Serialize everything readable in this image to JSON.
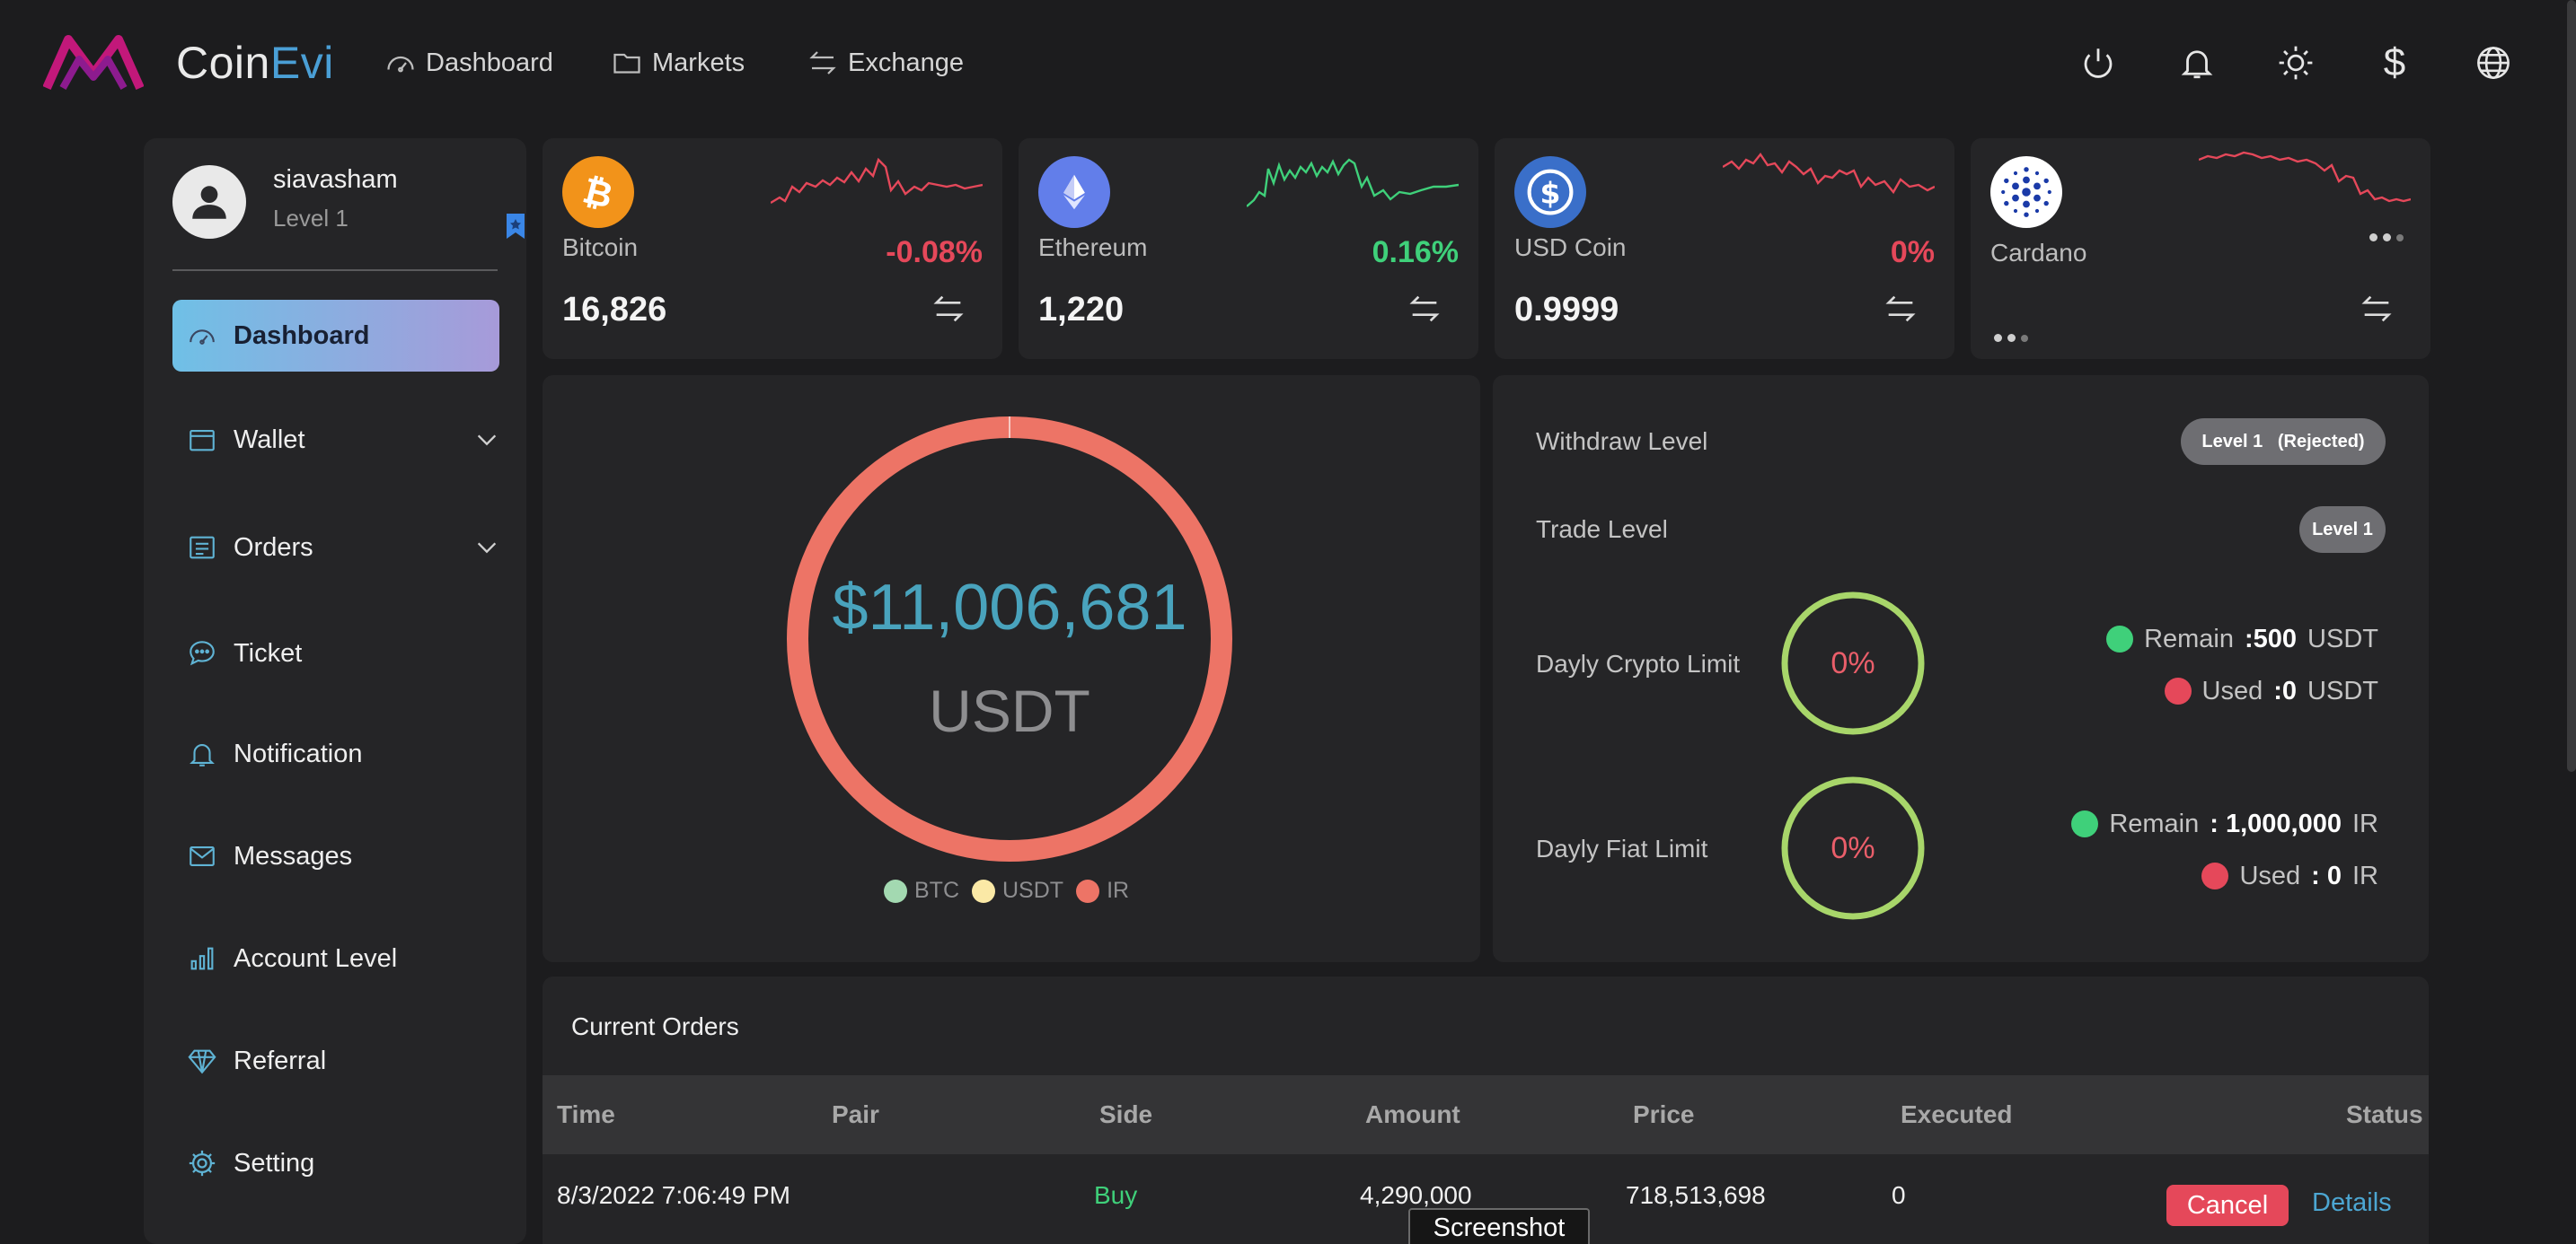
{
  "app": {
    "brand_part1": "Coin",
    "brand_part2": "Evi",
    "colors": {
      "accent_blue": "#4a9fd6",
      "positive": "#3fd07a",
      "negative": "#e5485a",
      "teal": "#49a3bd",
      "lime": "#a8d66a"
    }
  },
  "topnav": {
    "items": [
      {
        "label": "Dashboard",
        "icon": "speedometer-icon"
      },
      {
        "label": "Markets",
        "icon": "folder-icon"
      },
      {
        "label": "Exchange",
        "icon": "swap-icon"
      }
    ],
    "right_icons": [
      "power-icon",
      "bell-icon",
      "sun-icon",
      "dollar-icon",
      "globe-icon"
    ],
    "currency_symbol": "$"
  },
  "sidebar": {
    "profile": {
      "name": "siavasham",
      "level": "Level 1"
    },
    "items": [
      {
        "label": "Dashboard",
        "icon": "speedometer-icon",
        "active": true
      },
      {
        "label": "Wallet",
        "icon": "wallet-icon",
        "has_submenu": true
      },
      {
        "label": "Orders",
        "icon": "list-icon",
        "has_submenu": true
      },
      {
        "label": "Ticket",
        "icon": "chat-bubble-icon"
      },
      {
        "label": "Notification",
        "icon": "bell-icon"
      },
      {
        "label": "Messages",
        "icon": "envelope-icon"
      },
      {
        "label": "Account Level",
        "icon": "bar-chart-icon"
      },
      {
        "label": "Referral",
        "icon": "diamond-icon"
      },
      {
        "label": "Setting",
        "icon": "gear-icon"
      }
    ]
  },
  "coins": [
    {
      "name": "Bitcoin",
      "change": "-0.08%",
      "price": "16,826",
      "trend": "negative",
      "logo_color": "#f2931a",
      "icon": "bitcoin-icon"
    },
    {
      "name": "Ethereum",
      "change": "0.16%",
      "price": "1,220",
      "trend": "positive",
      "logo_color": "#627eea",
      "icon": "ethereum-icon"
    },
    {
      "name": "USD Coin",
      "change": "0%",
      "price": "0.9999",
      "trend": "negative",
      "logo_color": "#2775ca",
      "icon": "usd-coin-icon"
    },
    {
      "name": "Cardano",
      "change": "",
      "price": "",
      "trend": "negative",
      "logo_color": "#ffffff",
      "icon": "cardano-icon"
    }
  ],
  "balance": {
    "amount": "$11,006,681",
    "unit": "USDT",
    "legend": [
      {
        "label": "BTC",
        "color": "#a3d9b1"
      },
      {
        "label": "USDT",
        "color": "#fbe9a6"
      },
      {
        "label": "IR",
        "color": "#ed7466"
      }
    ]
  },
  "limits": {
    "withdraw_label": "Withdraw Level",
    "withdraw_badge": "Level 1   (Rejected)",
    "trade_label": "Trade Level",
    "trade_badge": "Level 1",
    "crypto": {
      "label": "Dayly Crypto Limit",
      "percent": "0%",
      "remain_label": "Remain",
      "remain_value": ":500",
      "remain_unit": "USDT",
      "used_label": "Used",
      "used_value": ":0",
      "used_unit": "USDT"
    },
    "fiat": {
      "label": "Dayly Fiat Limit",
      "percent": "0%",
      "remain_label": "Remain",
      "remain_value": ": 1,000,000",
      "remain_unit": "IR",
      "used_label": "Used",
      "used_value": ": 0",
      "used_unit": "IR"
    }
  },
  "orders": {
    "title": "Current Orders",
    "columns": [
      "Time",
      "Pair",
      "Side",
      "Amount",
      "Price",
      "Executed",
      "Status"
    ],
    "rows": [
      {
        "time": "8/3/2022 7:06:49 PM",
        "pair": "",
        "side": "Buy",
        "amount": "4,290,000",
        "price": "718,513,698",
        "executed": "0",
        "cancel": "Cancel",
        "details": "Details"
      }
    ]
  },
  "tooltip": "Screenshot"
}
